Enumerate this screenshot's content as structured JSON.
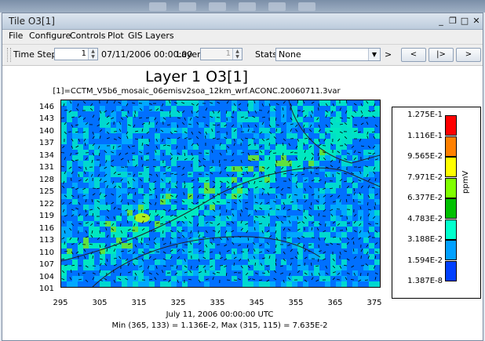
{
  "window": {
    "title": "Tile O3[1]",
    "icon": "app-tile-icon"
  },
  "menubar": {
    "file": "File",
    "configure": "Configure",
    "controls": "Controls",
    "plot": "Plot",
    "gis_layers": "GIS Layers"
  },
  "toolbar": {
    "time_step_label": "Time Step:",
    "time_step_value": "1",
    "time_text": "07/11/2006 00:00:00",
    "layer_label": "Layer:",
    "layer_value": "1",
    "stats_label": "Stats:",
    "stats_value": "None",
    "arrow_text": ">",
    "prev_label": "<",
    "play_label": "|>",
    "next_label": ">"
  },
  "plot": {
    "title": "Layer 1 O3[1]",
    "subtitle": "[1]=CCTM_V5b6_mosaic_06emisv2soa_12km_wrf.ACONC.20060711.3var",
    "y_ticks": [
      "146",
      "143",
      "140",
      "137",
      "134",
      "131",
      "128",
      "125",
      "122",
      "119",
      "116",
      "113",
      "110",
      "107",
      "104",
      "101"
    ],
    "x_ticks": [
      "295",
      "305",
      "315",
      "325",
      "335",
      "345",
      "355",
      "365",
      "375"
    ],
    "footer_time": "July 11, 2006 00:00:00 UTC",
    "footer_minmax": "Min (365, 133) = 1.136E-2, Max (315, 115) = 7.635E-2"
  },
  "legend": {
    "unit": "ppmV",
    "values": [
      "1.275E-1",
      "1.116E-1",
      "9.565E-2",
      "7.971E-2",
      "6.377E-2",
      "4.783E-2",
      "3.188E-2",
      "1.594E-2",
      "1.387E-8"
    ],
    "colors": [
      "#ff0000",
      "#ff8000",
      "#ffff00",
      "#80ff00",
      "#00c000",
      "#00ffcc",
      "#00a0ff",
      "#0040ff",
      "#dddddd"
    ]
  }
}
